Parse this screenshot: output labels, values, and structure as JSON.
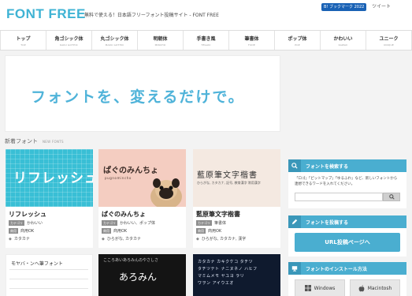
{
  "header": {
    "logo": "FONT FREE",
    "tagline": "無料で使える！日本語フリーフォント投稿サイト - FONT FREE",
    "bookmark": "B! ブックマーク 2022",
    "tweet": "ツイート"
  },
  "nav": {
    "items": [
      {
        "label": "トップ",
        "sub": "TOP"
      },
      {
        "label": "角ゴシック体",
        "sub": "KAKU GOTHIC"
      },
      {
        "label": "丸ゴシック体",
        "sub": "MARU GOTHIC"
      },
      {
        "label": "明朝体",
        "sub": "MINCHO"
      },
      {
        "label": "手書き風",
        "sub": "TEGAKI"
      },
      {
        "label": "筆書体",
        "sub": "FUDE"
      },
      {
        "label": "ポップ体",
        "sub": "POP"
      },
      {
        "label": "かわいい",
        "sub": "KAWAII"
      },
      {
        "label": "ユニーク",
        "sub": "UNIQUE"
      }
    ]
  },
  "banner": {
    "text": "フォントを、変えるだけで。"
  },
  "section": {
    "title": "新着フォント",
    "sub": "NEW FONTS"
  },
  "cards": [
    {
      "image_text": "リフレッシュ",
      "name": "リフレッシュ",
      "category_tag": "カテゴリ",
      "category": "かわいい",
      "license_tag": "商用",
      "license": "商用OK",
      "chars": "カタカナ"
    },
    {
      "image_text": "ぱぐのみんちょ",
      "image_sub": "pugnomincho",
      "name": "ぱぐのみんちょ",
      "category_tag": "カテゴリ",
      "category": "かわいい、ポップ体",
      "license_tag": "商用",
      "license": "商用OK",
      "chars": "ひらがな, カタカナ"
    },
    {
      "image_text": "藍原筆文字楷書",
      "image_sub": "ひらがな, カタカナ, 記号, 教育漢字 常用漢字",
      "name": "藍原筆文字楷書",
      "category_tag": "カテゴリ",
      "category": "筆書体",
      "license_tag": "商用",
      "license": "商用OK",
      "chars": "ひらがな, カタカナ, 漢字"
    }
  ],
  "row2": [
    {
      "line": "モヤバ・ンヘ筆フォント"
    },
    {
      "line": "こころあいあろみんのやさしさ",
      "big": "あろみん"
    },
    {
      "lines": [
        "カタカナ カキクケコ タチツ",
        "タチツテト ナニヌネノ ハヒフ",
        "マミムメモ ヤユヨ ラリ",
        "ワヲン アイウエオ"
      ]
    }
  ],
  "sidebar": {
    "search": {
      "title": "フォントを検索する",
      "desc": "「ロゴ」「ピットマップ」「ゆるふわ」など、新しいフォントから連想できるワードを入れてください。"
    },
    "post": {
      "title": "フォントを投稿する",
      "button": "URL投稿ページへ"
    },
    "install": {
      "title": "フォントのインストール方法",
      "windows": "Windows",
      "mac": "Macintosh"
    }
  },
  "colors": {
    "accent": "#4aaed0",
    "logo": "#3fb3d4",
    "bookmark": "#1a62b5"
  }
}
